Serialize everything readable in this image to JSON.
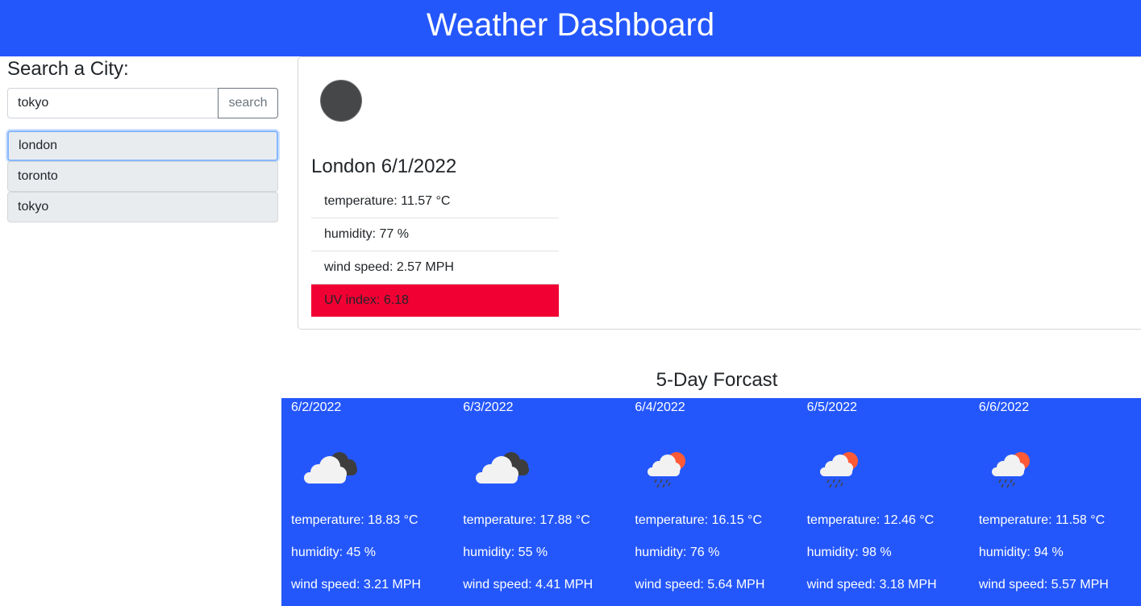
{
  "header": {
    "title": "Weather Dashboard"
  },
  "search": {
    "label": "Search a City:",
    "value": "tokyo",
    "button_label": "search"
  },
  "history": [
    {
      "label": "london",
      "active": true
    },
    {
      "label": "toronto",
      "active": false
    },
    {
      "label": "tokyo",
      "active": false
    }
  ],
  "current": {
    "icon": "overcast-clouds-icon",
    "title": "London 6/1/2022",
    "temperature": "temperature: 11.57 °C",
    "humidity": "humidity: 77 %",
    "wind": "wind speed: 2.57 MPH",
    "uv": "UV index: 6.18",
    "uv_color": "#f10033"
  },
  "forecast": {
    "title": "5-Day Forcast",
    "accent": "#2457fb",
    "days": [
      {
        "date": "6/2/2022",
        "icon": "broken-clouds-icon",
        "temperature": "temperature: 18.83 °C",
        "humidity": "humidity: 45 %",
        "wind": "wind speed: 3.21 MPH"
      },
      {
        "date": "6/3/2022",
        "icon": "broken-clouds-icon",
        "temperature": "temperature: 17.88 °C",
        "humidity": "humidity: 55 %",
        "wind": "wind speed: 4.41 MPH"
      },
      {
        "date": "6/4/2022",
        "icon": "light-rain-icon",
        "temperature": "temperature: 16.15 °C",
        "humidity": "humidity: 76 %",
        "wind": "wind speed: 5.64 MPH"
      },
      {
        "date": "6/5/2022",
        "icon": "light-rain-icon",
        "temperature": "temperature: 12.46 °C",
        "humidity": "humidity: 98 %",
        "wind": "wind speed: 3.18 MPH"
      },
      {
        "date": "6/6/2022",
        "icon": "light-rain-icon",
        "temperature": "temperature: 11.58 °C",
        "humidity": "humidity: 94 %",
        "wind": "wind speed: 5.57 MPH"
      }
    ]
  }
}
